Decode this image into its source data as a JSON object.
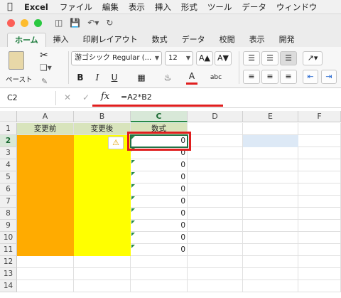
{
  "menubar": {
    "app": "Excel",
    "items": [
      "ファイル",
      "編集",
      "表示",
      "挿入",
      "形式",
      "ツール",
      "データ",
      "ウィンドウ"
    ]
  },
  "tabs": [
    "ホーム",
    "挿入",
    "印刷レイアウト",
    "数式",
    "データ",
    "校閲",
    "表示",
    "開発"
  ],
  "ribbon": {
    "paste_label": "ペースト",
    "font_name": "游ゴシック Regular (...",
    "font_size": "12",
    "bold": "B",
    "italic": "I",
    "underline": "U",
    "font_color_glyph": "A",
    "font_color": "#e01e1e",
    "grow_font": "A▲",
    "shrink_font": "A▼"
  },
  "formula_bar": {
    "name_box": "C2",
    "fx_label": "fx",
    "formula": "=A2*B2"
  },
  "grid": {
    "columns": [
      "A",
      "B",
      "C",
      "D",
      "E",
      "F"
    ],
    "selected_column": "C",
    "rows": [
      "1",
      "2",
      "3",
      "4",
      "5",
      "6",
      "7",
      "8",
      "9",
      "10",
      "11",
      "12",
      "13",
      "14"
    ],
    "selected_row": "2",
    "headers": {
      "A1": "変更前",
      "B1": "変更後",
      "C1": "数式"
    },
    "c_values": [
      "0",
      "0",
      "0",
      "0",
      "0",
      "0",
      "0",
      "0",
      "0",
      "0"
    ],
    "colors": {
      "a_fill": "#ffab00",
      "b_fill": "#ffff00",
      "header_fill": "#d8e4bc",
      "e2_fill": "#dde9f6"
    }
  }
}
